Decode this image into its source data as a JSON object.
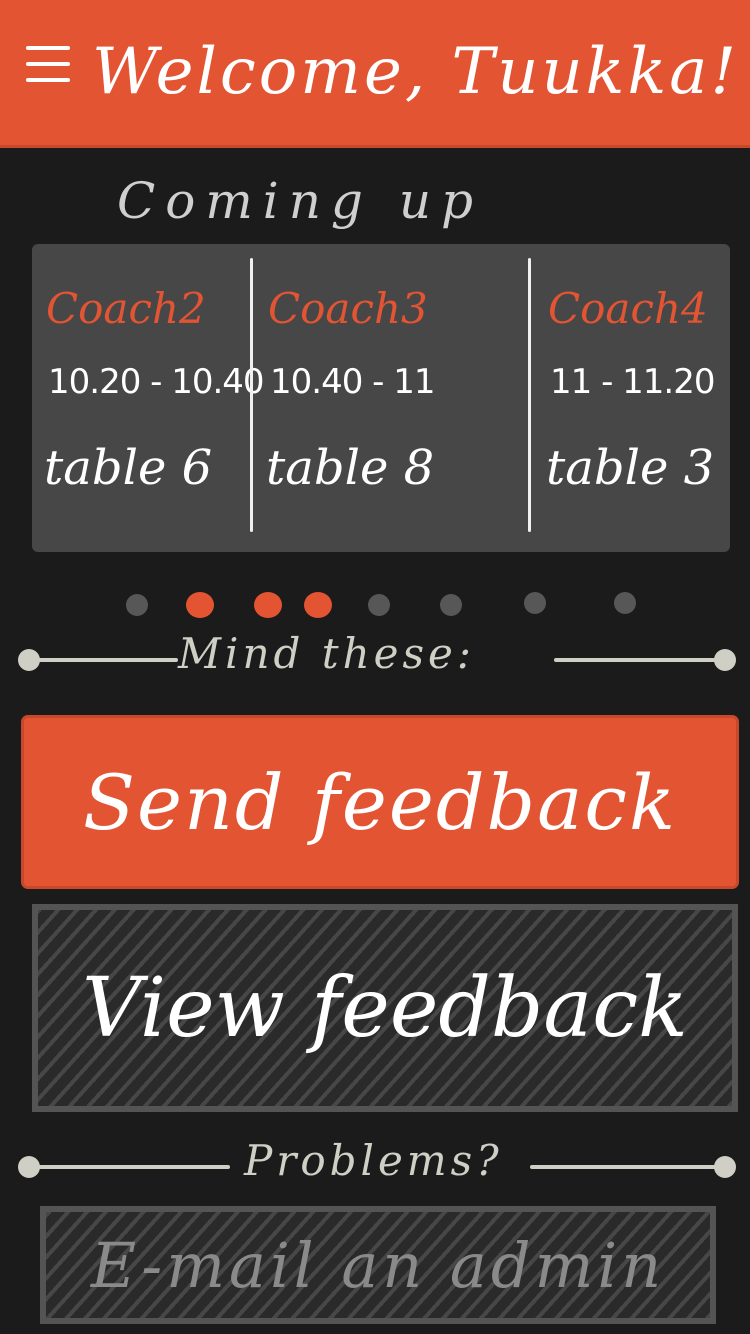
{
  "header": {
    "title": "Welcome, Tuukka!",
    "menu_icon": "hamburger-icon"
  },
  "upcoming": {
    "heading": "Coming up",
    "slots": [
      {
        "coach": "Coach2",
        "time": "10.20 - 10.40",
        "table": "table 6"
      },
      {
        "coach": "Coach3",
        "time": "10.40 - 11",
        "table": "table 8"
      },
      {
        "coach": "Coach4",
        "time": "11 - 11.20",
        "table": "table 3"
      }
    ],
    "pager": {
      "count": 8,
      "active_indices": [
        1,
        2,
        3
      ]
    }
  },
  "mind_these": {
    "label": "Mind these:"
  },
  "actions": {
    "send_feedback": "Send feedback",
    "view_feedback": "View feedback"
  },
  "problems": {
    "label": "Problems?",
    "email_admin": "E-mail an admin"
  },
  "colors": {
    "accent": "#e35433",
    "background": "#1b1b1b",
    "panel": "#474747",
    "muted_line": "#cfcfc6"
  }
}
